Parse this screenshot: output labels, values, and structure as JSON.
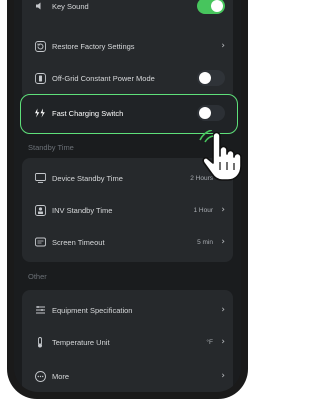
{
  "settings": {
    "key_sound": {
      "label": "Key Sound",
      "enabled": true
    },
    "restore_factory": {
      "label": "Restore Factory Settings"
    },
    "off_grid_power": {
      "label": "Off-Grid Constant Power Mode",
      "enabled": false
    },
    "fast_charging": {
      "label": "Fast Charging Switch",
      "enabled": false
    }
  },
  "standby": {
    "section_title": "Standby Time",
    "device_standby": {
      "label": "Device Standby Time",
      "value": "2 Hours"
    },
    "inv_standby": {
      "label": "INV Standby Time",
      "value": "1 Hour"
    },
    "screen_timeout": {
      "label": "Screen Timeout",
      "value": "5 min"
    }
  },
  "other": {
    "section_title": "Other",
    "equipment_spec": {
      "label": "Equipment Specification"
    },
    "temperature_unit": {
      "label": "Temperature Unit",
      "value": "°F"
    },
    "more": {
      "label": "More"
    }
  },
  "colors": {
    "accent_green": "#47c55d",
    "highlight_border": "#5ee07a",
    "card_bg": "#26292c",
    "screen_bg": "#1a1c1e"
  },
  "icons": {
    "key_sound": "speaker-icon",
    "restore_factory": "reset-icon",
    "off_grid_power": "battery-icon",
    "fast_charging": "lightning-icon",
    "device_standby": "monitor-icon",
    "inv_standby": "inverter-icon",
    "screen_timeout": "screen-icon",
    "equipment_spec": "spec-icon",
    "temperature_unit": "thermometer-icon",
    "more": "more-icon",
    "pointer": "hand-pointer-icon"
  }
}
